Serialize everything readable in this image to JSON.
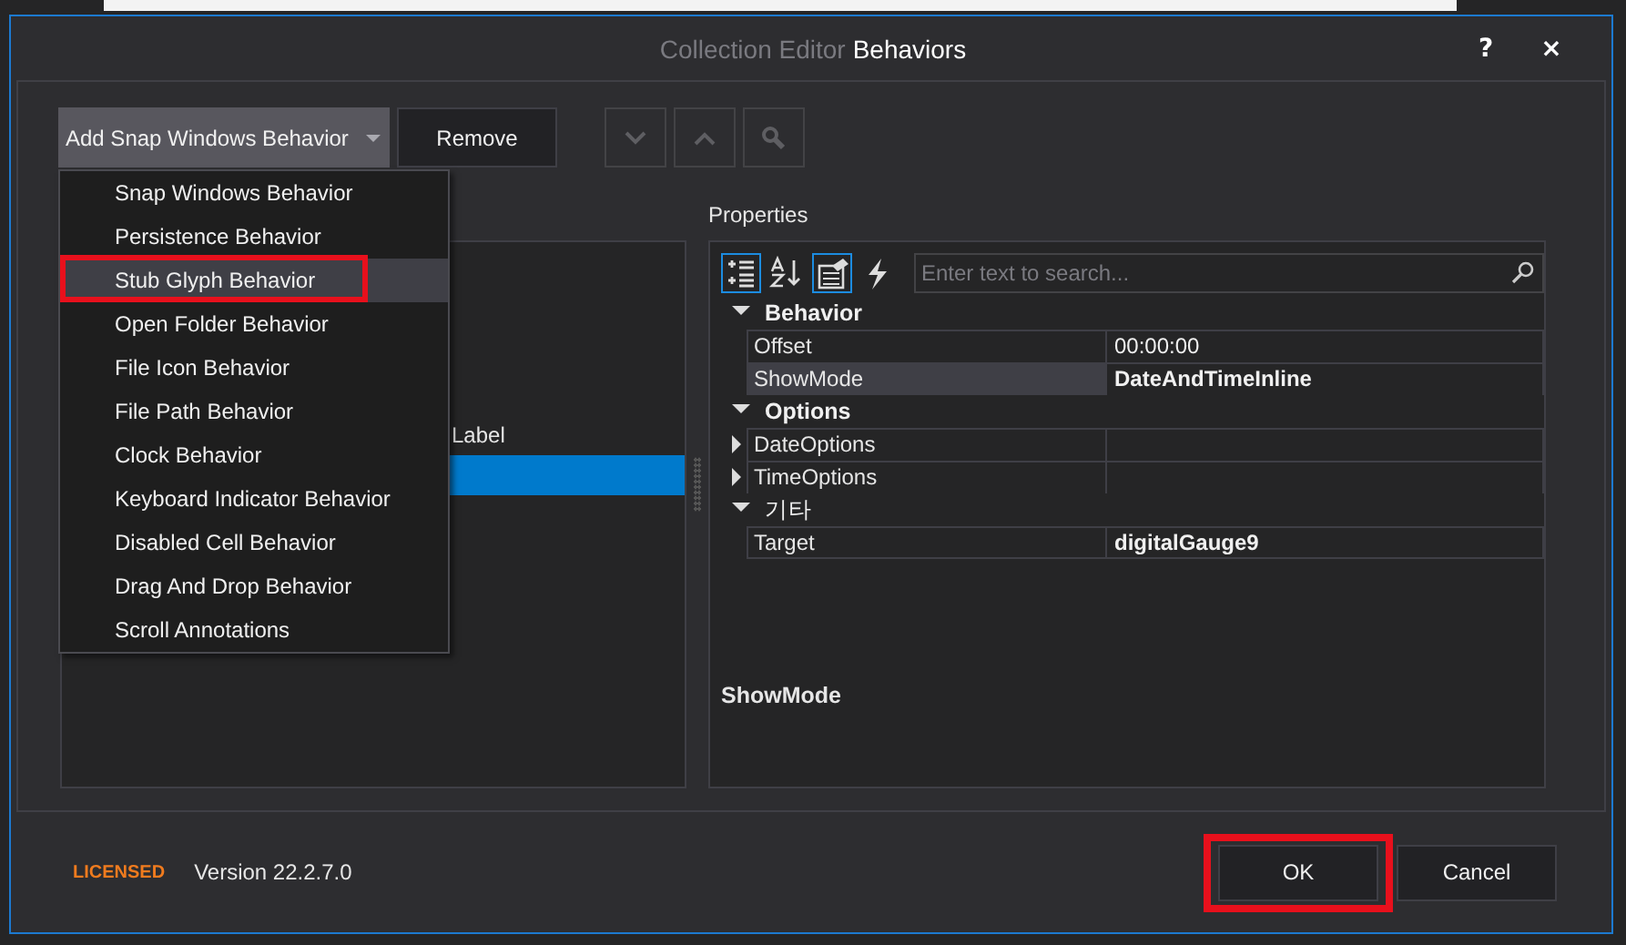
{
  "window": {
    "title_prefix": "Collection Editor",
    "title": "Behaviors",
    "help": "?",
    "close": "×"
  },
  "toolbar": {
    "add_button": "Add Snap Windows Behavior",
    "remove_button": "Remove",
    "nav_buttons": [
      {
        "kind": "down",
        "disabled": true
      },
      {
        "kind": "up",
        "disabled": true
      },
      {
        "kind": "search",
        "disabled": true
      }
    ]
  },
  "dropdown": {
    "items": [
      {
        "label": "Snap Windows Behavior",
        "selected": false,
        "annotated": false
      },
      {
        "label": "Persistence Behavior",
        "selected": false,
        "annotated": false
      },
      {
        "label": "Stub Glyph Behavior",
        "selected": true,
        "annotated": true
      },
      {
        "label": "Open Folder Behavior",
        "selected": false,
        "annotated": false
      },
      {
        "label": "File Icon Behavior",
        "selected": false,
        "annotated": false
      },
      {
        "label": "File Path Behavior",
        "selected": false,
        "annotated": false
      },
      {
        "label": "Clock Behavior",
        "selected": false,
        "annotated": false
      },
      {
        "label": "Keyboard Indicator Behavior",
        "selected": false,
        "annotated": false
      },
      {
        "label": "Disabled Cell Behavior",
        "selected": false,
        "annotated": false
      },
      {
        "label": "Drag And Drop Behavior",
        "selected": false,
        "annotated": false
      },
      {
        "label": "Scroll Annotations",
        "selected": false,
        "annotated": false
      }
    ]
  },
  "members": {
    "items": [
      {
        "text": "Label",
        "selected": false
      },
      {
        "selected": true
      }
    ]
  },
  "properties": {
    "label": "Properties",
    "tools": [
      {
        "kind": "categorized",
        "selected": true
      },
      {
        "kind": "alphabetical",
        "selected": false
      },
      {
        "kind": "pages",
        "selected": true
      },
      {
        "kind": "events",
        "selected": false
      }
    ],
    "search": {
      "placeholder": "Enter text to search..."
    },
    "categories": [
      {
        "name": "Behavior",
        "bold": true,
        "expanded": true,
        "rows": [
          {
            "name": "Offset",
            "value": "00:00:00",
            "modified": false,
            "selected": false
          },
          {
            "name": "ShowMode",
            "value": "DateAndTimeInline",
            "modified": true,
            "selected": true
          }
        ]
      },
      {
        "name": "Options",
        "bold": true,
        "expanded": true,
        "rows": [
          {
            "name": "DateOptions",
            "expandable": true,
            "selected": false
          },
          {
            "name": "TimeOptions",
            "expandable": true,
            "selected": false
          }
        ]
      },
      {
        "name": "기타",
        "bold": false,
        "expanded": true,
        "rows": [
          {
            "name": "Target",
            "value": "digitalGauge9",
            "modified": true,
            "selected": false
          }
        ]
      }
    ],
    "description": "ShowMode"
  },
  "footer": {
    "license": "LICENSED",
    "version": "Version 22.2.7.0",
    "buttons": [
      {
        "label": "OK",
        "annotated": true
      },
      {
        "label": "Cancel",
        "annotated": false
      }
    ]
  }
}
